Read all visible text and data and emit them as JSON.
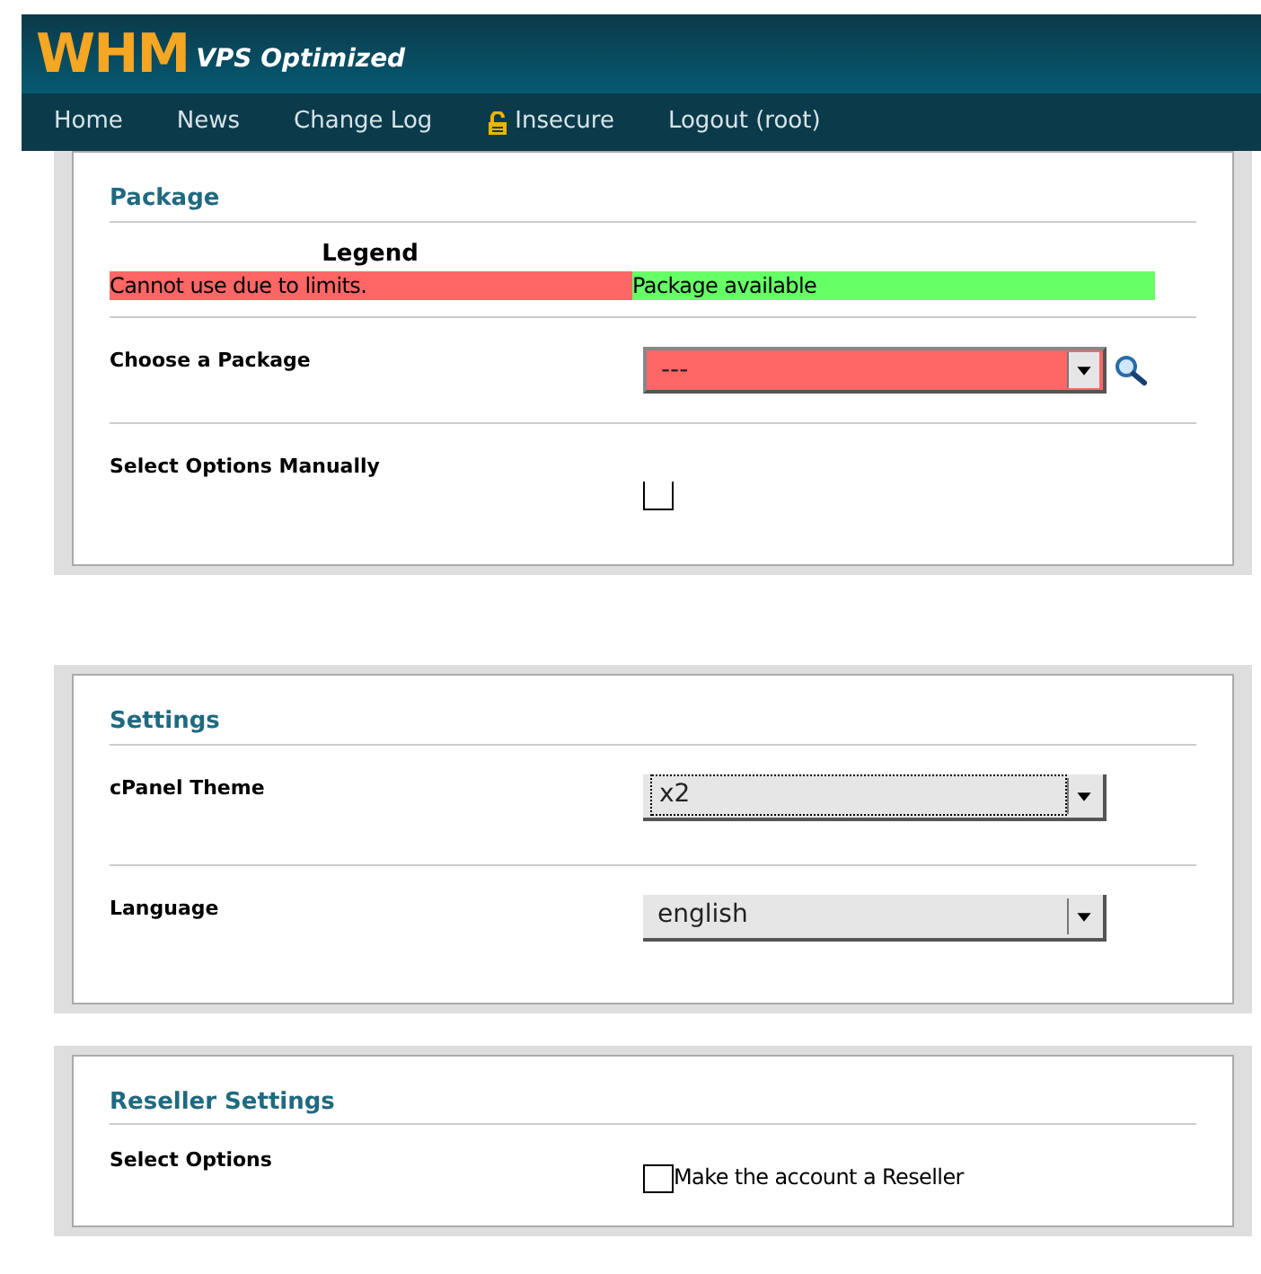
{
  "header": {
    "logo": "WHM",
    "subtitle": "VPS Optimized"
  },
  "nav": [
    {
      "label": "Home",
      "kind": "link"
    },
    {
      "label": "News",
      "kind": "link"
    },
    {
      "label": "Change Log",
      "kind": "link"
    },
    {
      "label": "Insecure",
      "kind": "lock"
    },
    {
      "label": "Logout (root)",
      "kind": "link"
    }
  ],
  "sections": [
    {
      "title": "Package",
      "legend": {
        "title": "Legend",
        "items": [
          {
            "text": "Cannot use due to limits.",
            "color": "#ff6666"
          },
          {
            "text": "Package available",
            "color": "#66ff66"
          }
        ]
      },
      "rows": [
        {
          "kind": "select",
          "label": "Choose a Package",
          "value": "---",
          "available": false,
          "focused": false,
          "search": true
        },
        {
          "kind": "checkbox",
          "label": "Select Options Manually",
          "checked": false
        }
      ]
    },
    {
      "title": "Settings",
      "rows": [
        {
          "kind": "select",
          "label": "cPanel Theme",
          "value": "x2",
          "focused": true
        },
        {
          "kind": "select",
          "label": "Language",
          "value": "english",
          "focused": false
        }
      ]
    },
    {
      "title": "Reseller Settings",
      "rows": [
        {
          "kind": "checkbox",
          "label": "Select Options",
          "checked": false,
          "option": "Make the account a Reseller"
        }
      ]
    }
  ]
}
